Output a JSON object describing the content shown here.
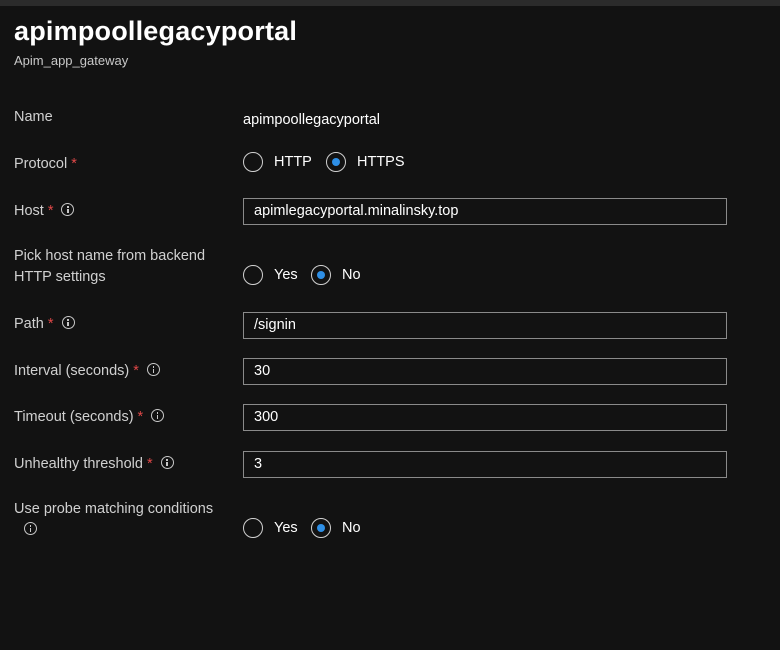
{
  "header": {
    "title": "apimpoollegacyportal",
    "subtitle": "Apim_app_gateway"
  },
  "form": {
    "name": {
      "label": "Name",
      "value": "apimpoollegacyportal"
    },
    "protocol": {
      "label": "Protocol",
      "required": "*",
      "options": [
        "HTTP",
        "HTTPS"
      ],
      "selected": "HTTPS"
    },
    "host": {
      "label": "Host",
      "required": "*",
      "value": "apimlegacyportal.minalinsky.top"
    },
    "pick_host": {
      "label_line1": "Pick host name from backend",
      "label_line2": "HTTP settings",
      "options": [
        "Yes",
        "No"
      ],
      "selected": "No"
    },
    "path": {
      "label": "Path",
      "required": "*",
      "value": "/signin"
    },
    "interval": {
      "label": "Interval (seconds)",
      "required": "*",
      "value": "30"
    },
    "timeout": {
      "label": "Timeout (seconds)",
      "required": "*",
      "value": "300"
    },
    "unhealthy": {
      "label": "Unhealthy threshold",
      "required": "*",
      "value": "3"
    },
    "probe_matching": {
      "label": "Use probe matching conditions",
      "options": [
        "Yes",
        "No"
      ],
      "selected": "No"
    }
  },
  "colors": {
    "background": "#121212",
    "accent": "#2e8fe6",
    "required": "#e04848"
  }
}
